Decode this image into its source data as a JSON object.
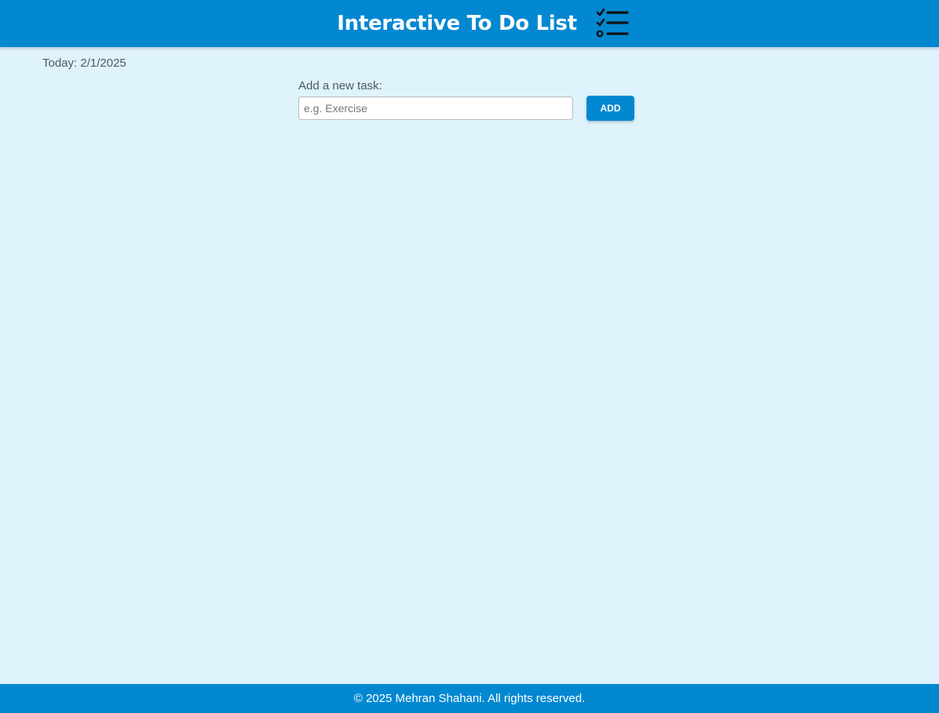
{
  "header": {
    "title": "Interactive To Do List",
    "icon": "checklist-icon"
  },
  "today": {
    "text": "Today: 2/1/2025"
  },
  "task_form": {
    "label": "Add a new task:",
    "input_value": "",
    "input_placeholder": "e.g. Exercise",
    "add_label": "ADD"
  },
  "tasks": [],
  "footer": {
    "text": "© 2025 Mehran Shahani. All rights reserved."
  },
  "colors": {
    "primary": "#0288d1",
    "background": "#dff3fc",
    "header_text": "#ffffff"
  }
}
